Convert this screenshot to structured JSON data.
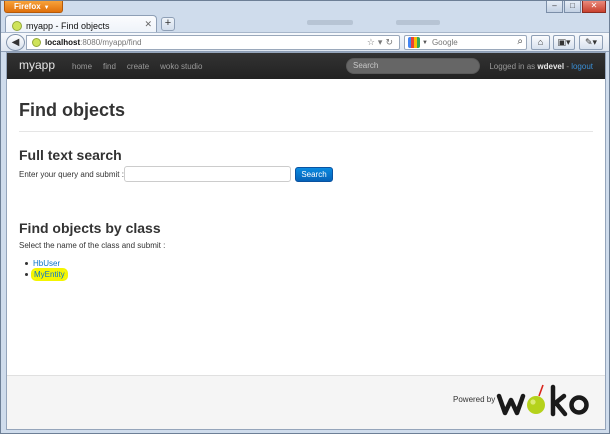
{
  "browser": {
    "menu_label": "Firefox",
    "tab_title": "myapp - Find objects",
    "url_host": "localhost",
    "url_path": ":8080/myapp/find",
    "search_placeholder": "Google",
    "win_minimize": "–",
    "win_restore": "□",
    "win_close": "✕"
  },
  "app": {
    "brand": "myapp",
    "nav": [
      "home",
      "find",
      "create",
      "woko studio"
    ],
    "search_placeholder": "Search",
    "login_prefix": "Logged in as ",
    "username": "wdevel",
    "separator": " - ",
    "logout": "logout"
  },
  "page": {
    "title": "Find objects",
    "fulltext": {
      "heading": "Full text search",
      "help": "Enter your query and submit :",
      "query_value": "",
      "button": "Search"
    },
    "byclass": {
      "heading": "Find objects by class",
      "help": "Select the name of the class and submit :",
      "classes": [
        {
          "name": "HbUser",
          "highlighted": false
        },
        {
          "name": "MyEntity",
          "highlighted": true
        }
      ]
    }
  },
  "footer": {
    "powered_by": "Powered by",
    "logo_text": "woko"
  },
  "colors": {
    "navbar": "#2b2b2b",
    "link": "#0a74c8",
    "button": "#0a74c8",
    "highlight": "#f4f500",
    "logo_green": "#b5d21b"
  }
}
